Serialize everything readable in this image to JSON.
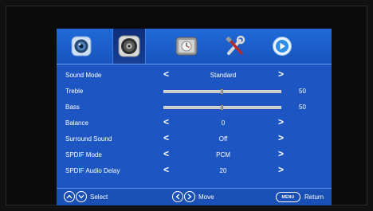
{
  "tabs": [
    {
      "name": "picture-icon",
      "selected": false
    },
    {
      "name": "sound-icon",
      "selected": true
    },
    {
      "name": "time-icon",
      "selected": false
    },
    {
      "name": "setup-icon",
      "selected": false
    },
    {
      "name": "media-icon",
      "selected": false
    }
  ],
  "settings": [
    {
      "label": "Sound Mode",
      "type": "select",
      "value": "Standard"
    },
    {
      "label": "Treble",
      "type": "slider",
      "value": "50",
      "level": 0.5
    },
    {
      "label": "Bass",
      "type": "slider",
      "value": "50",
      "level": 0.5
    },
    {
      "label": "Balance",
      "type": "select",
      "value": "0"
    },
    {
      "label": "Surround Sound",
      "type": "select",
      "value": "Off"
    },
    {
      "label": "SPDIF Mode",
      "type": "select",
      "value": "PCM"
    },
    {
      "label": "SPDIF Audio Delay",
      "type": "select",
      "value": "20"
    }
  ],
  "arrows": {
    "left": "<",
    "right": ">"
  },
  "footer": {
    "select_label": "Select",
    "move_label": "Move",
    "menu_key": "MENU",
    "return_label": "Return"
  },
  "colors": {
    "panel": "#1d56c2",
    "topbar": "#1f6ad8",
    "selected_tab": "#0e2f7a",
    "text": "#ffffff"
  }
}
